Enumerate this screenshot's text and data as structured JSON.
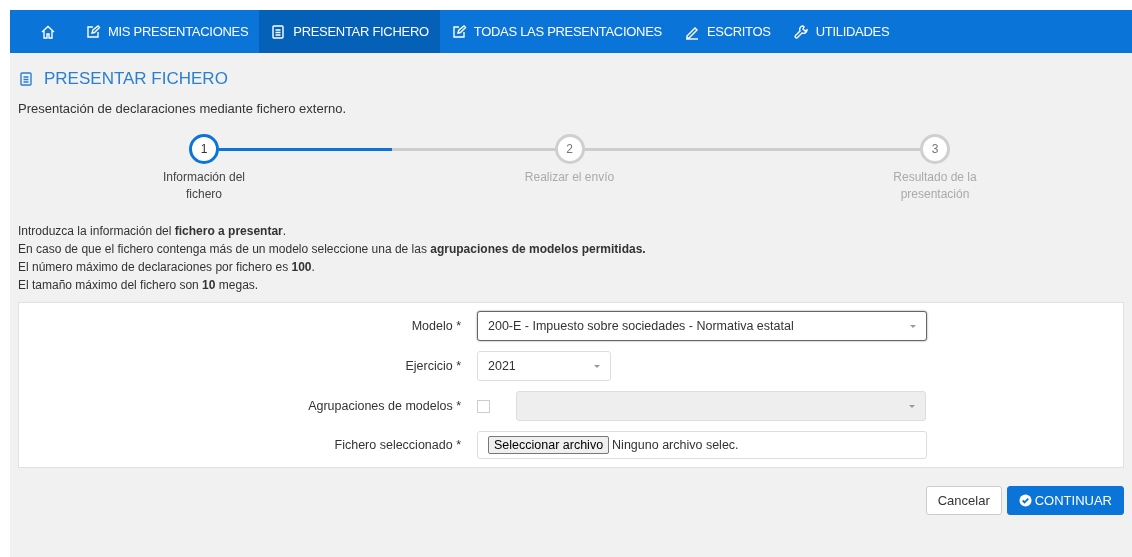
{
  "nav": [
    {
      "label": "MIS PRESENTACIONES",
      "selected": false
    },
    {
      "label": "PRESENTAR FICHERO",
      "selected": true
    },
    {
      "label": "TODAS LAS PRESENTACIONES",
      "selected": false
    },
    {
      "label": "ESCRITOS",
      "selected": false
    },
    {
      "label": "UTILIDADES",
      "selected": false
    }
  ],
  "page": {
    "title": "PRESENTAR FICHERO",
    "subtitle": "Presentación de declaraciones mediante fichero externo."
  },
  "steps": {
    "level": 0.247,
    "items": [
      {
        "number": "1",
        "label": "Información del fichero",
        "active": true
      },
      {
        "number": "2",
        "label": "Realizar el envío",
        "active": false
      },
      {
        "number": "3",
        "label": "Resultado de la presentación",
        "active": false
      }
    ]
  },
  "info": [
    "Introduzca la información del **fichero a presentar**.",
    "En caso de que el fichero contenga más de un modelo seleccione una de las **agrupaciones de modelos permitidas.**",
    "El número máximo de declaraciones por fichero es **100**.",
    "El tamaño máximo del fichero son **10** megas."
  ],
  "form": [
    {
      "kind": "select",
      "label": "Modelo *",
      "value": "200-E - Impuesto sobre sociedades - Normativa estatal",
      "focused": true,
      "wide": true
    },
    {
      "kind": "select",
      "label": "Ejercicio *",
      "value": "2021",
      "focused": false,
      "wide": false
    },
    {
      "kind": "checkbox-select",
      "label": "Agrupaciones de modelos *",
      "checked": false,
      "disabled": true
    },
    {
      "kind": "file",
      "label": "Fichero seleccionado *",
      "button": "Seleccionar archivo",
      "value": "Ninguno archivo selec."
    }
  ],
  "buttons": [
    {
      "kind": "secondary",
      "label": "Cancelar"
    },
    {
      "kind": "primary",
      "label": "CONTINUAR"
    }
  ]
}
